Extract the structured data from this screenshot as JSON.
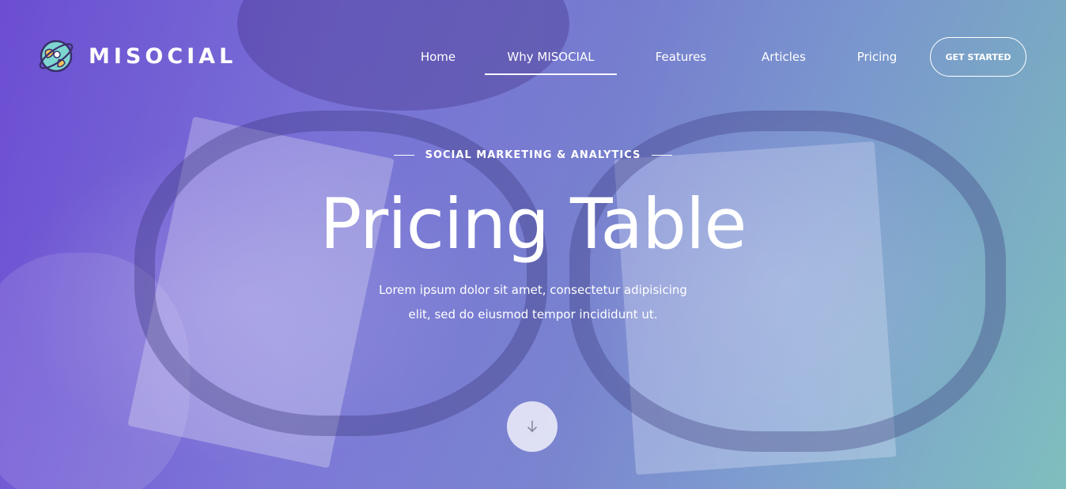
{
  "brand": {
    "name": "MISOCIAL",
    "logo_icon": "globe-rocket-icon"
  },
  "nav": {
    "items": [
      {
        "label": "Home",
        "active": false
      },
      {
        "label": "Why MISOCIAL",
        "active": true
      },
      {
        "label": "Features",
        "active": false
      },
      {
        "label": "Articles",
        "active": false
      },
      {
        "label": "Pricing",
        "active": false
      }
    ],
    "cta_label": "GET STARTED"
  },
  "hero": {
    "kicker": "SOCIAL MARKETING & ANALYTICS",
    "title": "Pricing Table",
    "subtitle": "Lorem ipsum dolor sit amet, consectetur adipisicing elit, sed do eiusmod tempor incididunt ut.",
    "scroll_icon": "arrow-down-icon"
  },
  "colors": {
    "gradient_start": "#6f4fd4",
    "gradient_end": "#7fc3bd",
    "text": "#ffffff"
  }
}
